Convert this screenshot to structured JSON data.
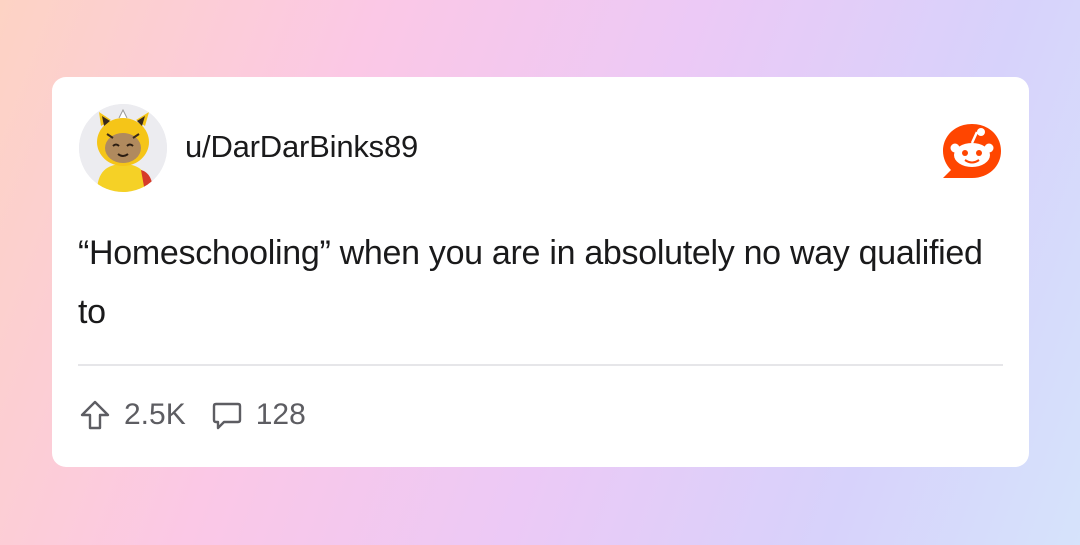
{
  "post": {
    "username": "u/DarDarBinks89",
    "text": "“Homeschooling” when you are in absolutely no way qualified to",
    "upvotes": "2.5K",
    "comments": "128"
  },
  "icons": {
    "avatar": "snoo-avatar-in-yellow-costume",
    "brand": "reddit-logo-icon",
    "upvote": "upvote-arrow-icon",
    "comment": "comment-bubble-icon"
  },
  "colors": {
    "brand": "#ff4500",
    "text": "#1a1a1b",
    "muted": "#5d5d62"
  }
}
